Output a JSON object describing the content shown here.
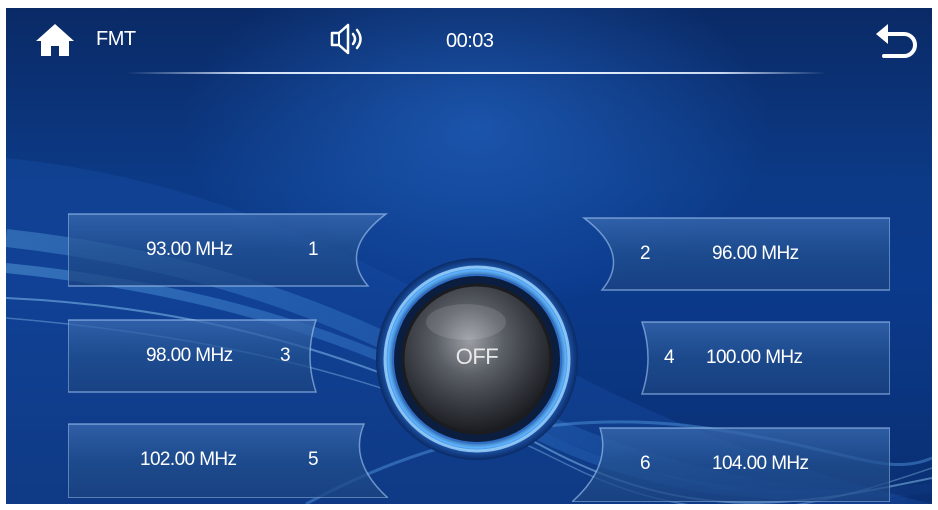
{
  "header": {
    "title": "FMT",
    "clock": "00:03",
    "icons": [
      "home-icon",
      "speaker-icon",
      "back-arrow-icon"
    ]
  },
  "presets": [
    {
      "number": "1",
      "frequency": "93.00 MHz"
    },
    {
      "number": "2",
      "frequency": "96.00 MHz"
    },
    {
      "number": "3",
      "frequency": "98.00 MHz"
    },
    {
      "number": "4",
      "frequency": "100.00 MHz"
    },
    {
      "number": "5",
      "frequency": "102.00 MHz"
    },
    {
      "number": "6",
      "frequency": "104.00 MHz"
    }
  ],
  "power_button": {
    "label": "OFF"
  },
  "colors": {
    "background": "#0b3a8c",
    "button_face": "#4a4d52",
    "ring": "#7cc6ff",
    "text": "#ffffff"
  }
}
